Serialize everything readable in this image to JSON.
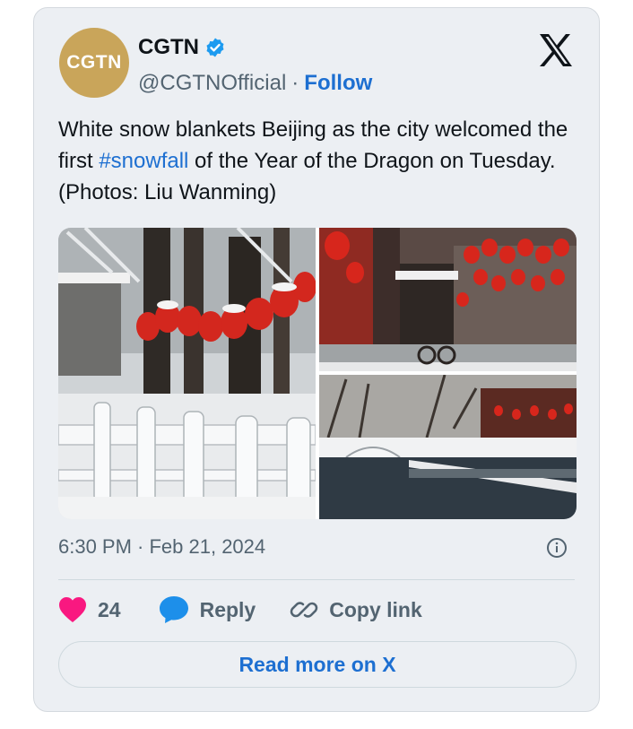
{
  "author": {
    "avatar_text": "CGTN",
    "name": "CGTN",
    "handle": "@CGTNOfficial",
    "separator": "·",
    "follow_label": "Follow"
  },
  "tweet": {
    "text_before": "White snow blankets Beijing as the city welcomed the first ",
    "hashtag": "#snowfall",
    "text_after": " of the Year of the Dragon on Tuesday. (Photos: Liu Wanming)"
  },
  "media": {
    "photos": [
      {
        "subject": "snow-covered-railing-with-red-lanterns"
      },
      {
        "subject": "hutong-street-with-red-lanterns"
      },
      {
        "subject": "snowy-canal-with-bridge"
      }
    ]
  },
  "timestamp": "6:30 PM · Feb 21, 2024",
  "actions": {
    "like_count": "24",
    "reply_label": "Reply",
    "copy_label": "Copy link"
  },
  "read_more_label": "Read more on X",
  "colors": {
    "accent": "#1d6fd1",
    "like": "#f91880",
    "avatar_gold": "#c9a55a",
    "card_bg": "#eceff3"
  }
}
